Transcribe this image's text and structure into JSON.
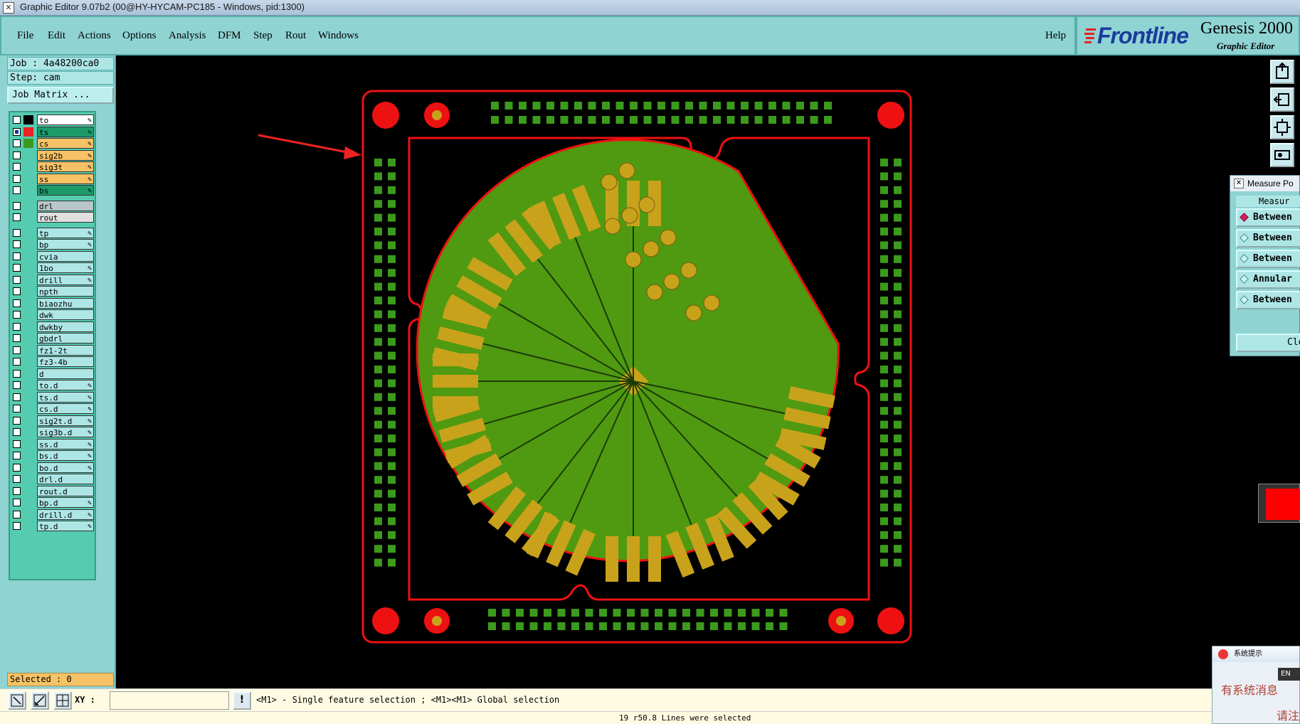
{
  "window": {
    "title": "Graphic Editor 9.07b2 (00@HY-HYCAM-PC185 - Windows, pid:1300)",
    "icon": "x-window-icon"
  },
  "menu": {
    "items": [
      "File",
      "Edit",
      "Actions",
      "Options",
      "Analysis",
      "DFM",
      "Step",
      "Rout",
      "Windows"
    ],
    "help": "Help"
  },
  "brand": {
    "logo": "Frontline",
    "product": "Genesis 2000",
    "subtitle": "Graphic Editor"
  },
  "job": {
    "job_line": "Job : 4a48200ca0",
    "step_line": "Step: cam",
    "matrix_button": "Job Matrix ..."
  },
  "layers": [
    {
      "name": "to",
      "color": "#000000",
      "bg": "#ffffff",
      "edit": true,
      "checked": false
    },
    {
      "name": "ts",
      "color": "#ee2222",
      "bg": "#1c9a6a",
      "edit": true,
      "checked": true
    },
    {
      "name": "cs",
      "color": "#3c9a1c",
      "bg": "#f7c266",
      "edit": true,
      "checked": false
    },
    {
      "name": "sig2b",
      "color": "",
      "bg": "#f7c266",
      "edit": true,
      "checked": false
    },
    {
      "name": "sig3t",
      "color": "",
      "bg": "#f7c266",
      "edit": true,
      "checked": false
    },
    {
      "name": "ss",
      "color": "",
      "bg": "#f7c266",
      "edit": true,
      "checked": false
    },
    {
      "name": "bs",
      "color": "",
      "bg": "#1c9a6a",
      "edit": true,
      "checked": false
    },
    {
      "name": "drl",
      "color": "",
      "bg": "#b8c8c8",
      "edit": false,
      "checked": false
    },
    {
      "name": "rout",
      "color": "",
      "bg": "#e0e0e0",
      "edit": false,
      "checked": false
    },
    {
      "name": "tp",
      "color": "",
      "bg": "#aee6e6",
      "edit": true,
      "checked": false
    },
    {
      "name": "bp",
      "color": "",
      "bg": "#aee6e6",
      "edit": true,
      "checked": false
    },
    {
      "name": "cvia",
      "color": "",
      "bg": "#aee6e6",
      "edit": false,
      "checked": false
    },
    {
      "name": "1bo",
      "color": "",
      "bg": "#aee6e6",
      "edit": true,
      "checked": false
    },
    {
      "name": "drill",
      "color": "",
      "bg": "#aee6e6",
      "edit": true,
      "checked": false
    },
    {
      "name": "npth",
      "color": "",
      "bg": "#aee6e6",
      "edit": false,
      "checked": false
    },
    {
      "name": "biaozhu",
      "color": "",
      "bg": "#aee6e6",
      "edit": false,
      "checked": false
    },
    {
      "name": "dwk",
      "color": "",
      "bg": "#aee6e6",
      "edit": false,
      "checked": false
    },
    {
      "name": "dwkby",
      "color": "",
      "bg": "#aee6e6",
      "edit": false,
      "checked": false
    },
    {
      "name": "gbdrl",
      "color": "",
      "bg": "#aee6e6",
      "edit": false,
      "checked": false
    },
    {
      "name": "fz1-2t",
      "color": "",
      "bg": "#aee6e6",
      "edit": false,
      "checked": false
    },
    {
      "name": "fz3-4b",
      "color": "",
      "bg": "#aee6e6",
      "edit": false,
      "checked": false
    },
    {
      "name": "d",
      "color": "",
      "bg": "#aee6e6",
      "edit": false,
      "checked": false
    },
    {
      "name": "to.d",
      "color": "",
      "bg": "#aee6e6",
      "edit": true,
      "checked": false
    },
    {
      "name": "ts.d",
      "color": "",
      "bg": "#aee6e6",
      "edit": true,
      "checked": false
    },
    {
      "name": "cs.d",
      "color": "",
      "bg": "#aee6e6",
      "edit": true,
      "checked": false
    },
    {
      "name": "sig2t.d",
      "color": "",
      "bg": "#aee6e6",
      "edit": true,
      "checked": false
    },
    {
      "name": "sig3b.d",
      "color": "",
      "bg": "#aee6e6",
      "edit": true,
      "checked": false
    },
    {
      "name": "ss.d",
      "color": "",
      "bg": "#aee6e6",
      "edit": true,
      "checked": false
    },
    {
      "name": "bs.d",
      "color": "",
      "bg": "#aee6e6",
      "edit": true,
      "checked": false
    },
    {
      "name": "bo.d",
      "color": "",
      "bg": "#aee6e6",
      "edit": true,
      "checked": false
    },
    {
      "name": "drl.d",
      "color": "",
      "bg": "#aee6e6",
      "edit": false,
      "checked": false
    },
    {
      "name": "rout.d",
      "color": "",
      "bg": "#aee6e6",
      "edit": false,
      "checked": false
    },
    {
      "name": "bp.d",
      "color": "",
      "bg": "#aee6e6",
      "edit": true,
      "checked": false
    },
    {
      "name": "drill.d",
      "color": "",
      "bg": "#aee6e6",
      "edit": true,
      "checked": false
    },
    {
      "name": "tp.d",
      "color": "",
      "bg": "#aee6e6",
      "edit": true,
      "checked": false
    }
  ],
  "selected": "Selected : 0",
  "measure": {
    "window_title": "Measure Po",
    "heading": "Measur",
    "options": [
      "Between",
      "Between",
      "Between",
      "Annular",
      "Between"
    ],
    "selected_index": 0,
    "close": "Clo"
  },
  "bottom": {
    "xy_label": "XY :",
    "xy_value": "",
    "hint_button": "!",
    "hint": "<M1> - Single feature selection ; <M1><M1> Global selection",
    "status": "19 r50.8 Lines were selected"
  },
  "popup": {
    "title": "系统提示",
    "line1": "有系统消息",
    "line2": "请注",
    "button": "EN"
  },
  "colors": {
    "menu_bg": "#8fd3d3",
    "board_green": "#4f9a10",
    "pad_gold": "#c9a21c",
    "outline_red": "#ee1111",
    "mask_green": "#3c9a1c"
  },
  "icons": {
    "bottom_tools": [
      "select-arrow-icon",
      "measure-icon",
      "grid-icon"
    ],
    "right_tools": [
      "zoom-home-icon",
      "zoom-back-icon",
      "fit-screen-icon",
      "snap-icon"
    ]
  }
}
